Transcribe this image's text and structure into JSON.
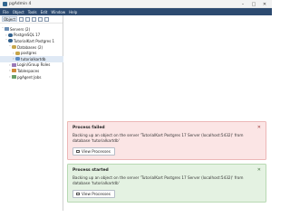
{
  "window": {
    "title": "pgAdmin 4"
  },
  "menu": [
    "File",
    "Object",
    "Tools",
    "Edit",
    "Window",
    "Help"
  ],
  "panel": {
    "tab": "Object"
  },
  "tree": [
    {
      "label": "Servers (2)",
      "level": 0,
      "state": "expanded",
      "icon": "servers-icon"
    },
    {
      "label": "PostgreSQL 17",
      "level": 1,
      "state": "collapsed",
      "icon": "elephant-icon"
    },
    {
      "label": "TutorialKart Postgres 1",
      "level": 1,
      "state": "expanded",
      "icon": "elephant-icon"
    },
    {
      "label": "Databases (2)",
      "level": 2,
      "state": "expanded",
      "icon": "databases-icon"
    },
    {
      "label": "postgres",
      "level": 3,
      "state": "collapsed",
      "icon": "database-icon"
    },
    {
      "label": "tutorialkartdb",
      "level": 3,
      "state": "collapsed",
      "icon": "database-icon",
      "selected": true
    },
    {
      "label": "Login/Group Roles",
      "level": 2,
      "state": "collapsed",
      "icon": "roles-icon"
    },
    {
      "label": "Tablespaces",
      "level": 2,
      "state": "collapsed",
      "icon": "tablespaces-icon"
    },
    {
      "label": "pgAgent Jobs",
      "level": 2,
      "state": "collapsed",
      "icon": "jobs-icon"
    }
  ],
  "notifications": {
    "failed": {
      "title": "Process failed",
      "message": "Backing up an object on the server 'TutorialKart Postgres 17 Server (localhost:5432)' from database 'tutorialkartdb'",
      "button": "View Processes"
    },
    "started": {
      "title": "Process started",
      "message": "Backing up an object on the server 'TutorialKart Postgres 17 Server (localhost:5432)' from database 'tutorialkartdb'",
      "button": "View Processes"
    }
  },
  "colors": {
    "menubar": "#2c4a70",
    "failed_bg": "#fbe5e5",
    "started_bg": "#e4f2e2",
    "highlight": "#ffec00"
  }
}
